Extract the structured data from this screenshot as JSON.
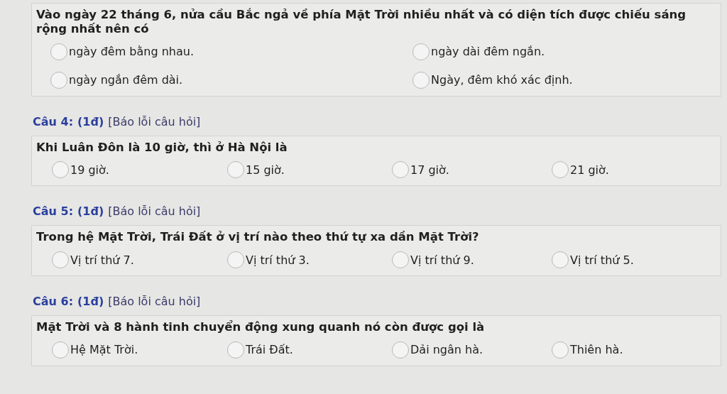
{
  "questions": [
    {
      "kind": "two-column",
      "prompt": "Vào ngày 22 tháng 6, nửa cầu Bắc ngả về phía Mặt Trời nhiều nhất và có diện tích được chiếu sáng rộng nhất nên có",
      "options": [
        {
          "label": "ngày đêm bằng nhau.",
          "selected": false
        },
        {
          "label": "ngày dài đêm ngắn.",
          "selected": false
        },
        {
          "label": "ngày ngắn đêm dài.",
          "selected": false
        },
        {
          "label": "Ngày, đêm khó xác định.",
          "selected": false
        }
      ]
    },
    {
      "kind": "four-column",
      "header": {
        "number": "Câu 4:",
        "points": "(1đ)",
        "report": "[Báo lỗi câu hỏi]"
      },
      "prompt": "Khi Luân Đôn là 10 giờ, thì ở Hà Nội là",
      "options": [
        {
          "label": "19 giờ.",
          "selected": false
        },
        {
          "label": "15 giờ.",
          "selected": false
        },
        {
          "label": "17 giờ.",
          "selected": false
        },
        {
          "label": "21 giờ.",
          "selected": false
        }
      ]
    },
    {
      "kind": "four-column",
      "header": {
        "number": "Câu 5:",
        "points": "(1đ)",
        "report": "[Báo lỗi câu hỏi]"
      },
      "prompt": "Trong hệ Mặt Trời, Trái Đất ở vị trí nào theo thứ tự xa dần Mặt Trời?",
      "options": [
        {
          "label": "Vị trí thứ 7.",
          "selected": false
        },
        {
          "label": "Vị trí thứ 3.",
          "selected": false
        },
        {
          "label": "Vị trí thứ 9.",
          "selected": false
        },
        {
          "label": "Vị trí thứ 5.",
          "selected": false
        }
      ]
    },
    {
      "kind": "four-column",
      "header": {
        "number": "Câu 6:",
        "points": "(1đ)",
        "report": "[Báo lỗi câu hỏi]"
      },
      "prompt": "Mặt Trời và 8 hành tinh chuyển động xung quanh nó còn được gọi là",
      "options": [
        {
          "label": "Hệ Mặt Trời.",
          "selected": false
        },
        {
          "label": "Trái Đất.",
          "selected": false
        },
        {
          "label": "Dải ngân hà.",
          "selected": false
        },
        {
          "label": "Thiên hà.",
          "selected": false
        }
      ]
    }
  ]
}
